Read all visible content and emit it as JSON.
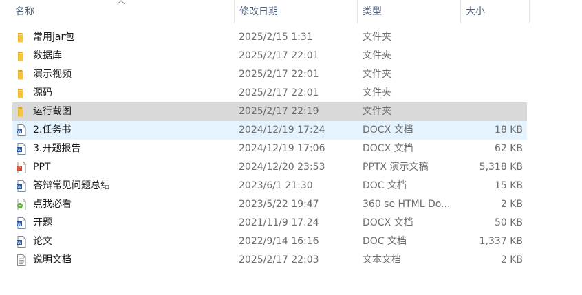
{
  "columns": {
    "name": "名称",
    "date": "修改日期",
    "type": "类型",
    "size": "大小"
  },
  "colors": {
    "folder": "#f5c542",
    "word": "#2b579a",
    "ppt": "#d24726",
    "html": "#5fb332",
    "selected_bg": "#d9d9d9",
    "hover_bg": "#e5f3ff"
  },
  "files": [
    {
      "name": "常用jar包",
      "date": "2025/2/15 1:31",
      "type": "文件夹",
      "size": "",
      "icon": "folder-icon"
    },
    {
      "name": "数据库",
      "date": "2025/2/17 22:01",
      "type": "文件夹",
      "size": "",
      "icon": "folder-icon"
    },
    {
      "name": "演示视频",
      "date": "2025/2/17 22:01",
      "type": "文件夹",
      "size": "",
      "icon": "folder-icon"
    },
    {
      "name": "源码",
      "date": "2025/2/17 22:01",
      "type": "文件夹",
      "size": "",
      "icon": "folder-icon"
    },
    {
      "name": "运行截图",
      "date": "2025/2/17 22:19",
      "type": "文件夹",
      "size": "",
      "icon": "folder-icon",
      "state": "selected"
    },
    {
      "name": "2.任务书",
      "date": "2024/12/19 17:24",
      "type": "DOCX 文档",
      "size": "18 KB",
      "icon": "word-doc-icon",
      "state": "hover"
    },
    {
      "name": "3.开题报告",
      "date": "2024/12/19 17:06",
      "type": "DOCX 文档",
      "size": "62 KB",
      "icon": "word-doc-icon"
    },
    {
      "name": "PPT",
      "date": "2024/12/20 23:53",
      "type": "PPTX 演示文稿",
      "size": "5,318 KB",
      "icon": "ppt-icon"
    },
    {
      "name": "答辩常见问题总结",
      "date": "2023/6/1 21:30",
      "type": "DOC 文档",
      "size": "15 KB",
      "icon": "word-doc-icon"
    },
    {
      "name": "点我必看",
      "date": "2023/5/22 19:47",
      "type": "360 se HTML Do...",
      "size": "2 KB",
      "icon": "html-icon"
    },
    {
      "name": "开题",
      "date": "2021/11/9 17:24",
      "type": "DOCX 文档",
      "size": "50 KB",
      "icon": "word-doc-icon"
    },
    {
      "name": "论文",
      "date": "2022/9/14 16:16",
      "type": "DOC 文档",
      "size": "1,337 KB",
      "icon": "word-doc-icon"
    },
    {
      "name": "说明文档",
      "date": "2025/2/17 22:03",
      "type": "文本文档",
      "size": "2 KB",
      "icon": "text-doc-icon"
    }
  ]
}
